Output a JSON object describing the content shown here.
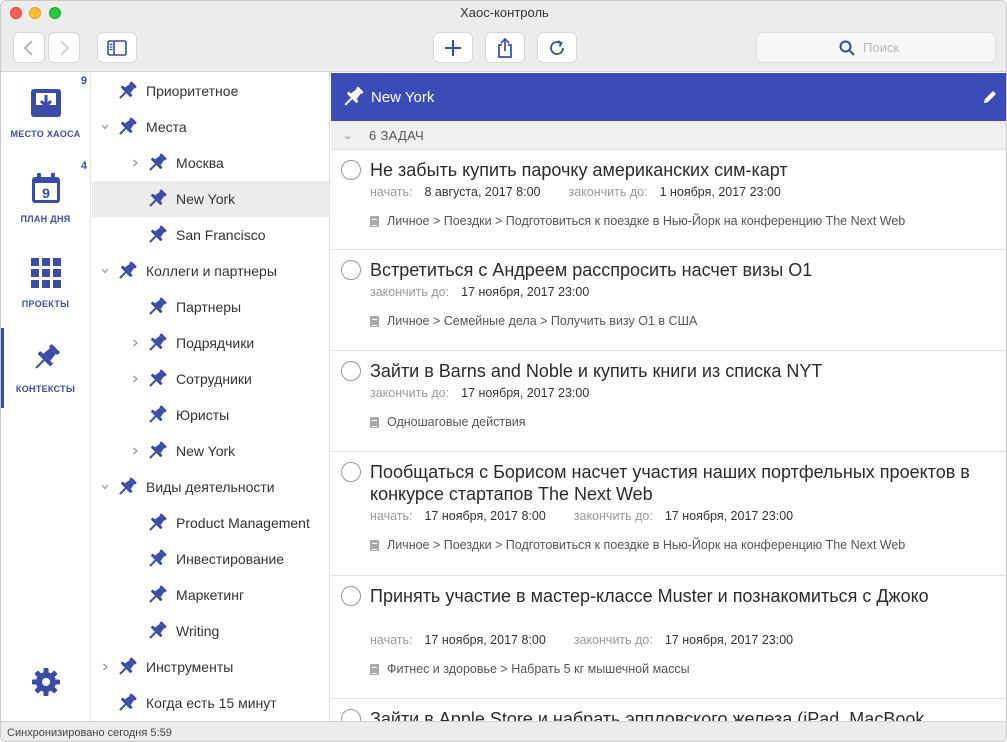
{
  "window": {
    "title": "Хаос-контроль"
  },
  "toolbar": {
    "back_icon": "chevron-left-icon",
    "forward_icon": "chevron-right-icon",
    "sidebar_icon": "sidebar-icon",
    "add_icon": "plus-icon",
    "share_icon": "share-icon",
    "sync_icon": "refresh-icon",
    "search_placeholder": "Поиск"
  },
  "rail": {
    "items": [
      {
        "label": "МЕСТО ХАОСА",
        "count": "9",
        "icon": "inbox-icon"
      },
      {
        "label": "ПЛАН ДНЯ",
        "count": "4",
        "icon": "calendar-icon",
        "calendar_day": "9"
      },
      {
        "label": "ПРОЕКТЫ",
        "count": "",
        "icon": "grid-icon"
      },
      {
        "label": "КОНТЕКСТЫ",
        "count": "",
        "icon": "pin-icon"
      }
    ],
    "settings_icon": "gear-icon"
  },
  "tree": {
    "items": [
      {
        "label": "Приоритетное"
      },
      {
        "label": "Места"
      },
      {
        "label": "Москва"
      },
      {
        "label": "New York"
      },
      {
        "label": "San Francisco"
      },
      {
        "label": "Коллеги и партнеры"
      },
      {
        "label": "Партнеры"
      },
      {
        "label": "Подрядчики"
      },
      {
        "label": "Сотрудники"
      },
      {
        "label": "Юристы"
      },
      {
        "label": "New York"
      },
      {
        "label": "Виды деятельности"
      },
      {
        "label": "Product Management"
      },
      {
        "label": "Инвестирование"
      },
      {
        "label": "Маркетинг"
      },
      {
        "label": "Writing"
      },
      {
        "label": "Инструменты"
      },
      {
        "label": "Когда есть 15 минут"
      }
    ]
  },
  "main": {
    "header_title": "New York",
    "task_count": "6 ЗАДАЧ",
    "tasks": [
      {
        "title": "Не забыть купить парочку американских сим-карт",
        "start_label": "начать:",
        "start": "8 августа, 2017 8:00",
        "due_label": "закончить до:",
        "due": "1 ноября, 2017 23:00",
        "path": "Личное > Поездки > Подготовиться к поездке в Нью-Йорк на конференцию The Next Web"
      },
      {
        "title": "Встретиться с Андреем расспросить насчет визы О1",
        "due_label": "закончить до:",
        "due": "17 ноября, 2017 23:00",
        "path": "Личное > Семейные дела > Получить визу О1 в США"
      },
      {
        "title": "Зайти в Barns and Noble и купить книги из списка NYT",
        "due_label": "закончить до:",
        "due": "17 ноября, 2017 23:00",
        "path": "Одношаговые действия"
      },
      {
        "title": "Пообщаться с Борисом насчет участия наших портфельных проектов в конкурсе стартапов The Next Web",
        "start_label": "начать:",
        "start": "17 ноября, 2017 8:00",
        "due_label": "закончить до:",
        "due": "17 ноября, 2017 23:00",
        "path": "Личное > Поездки > Подготовиться к поездке в Нью-Йорк на конференцию The Next Web"
      },
      {
        "title": "Принять участие в мастер-классе Muster и познакомиться с Джоко",
        "start_label": "начать:",
        "start": "17 ноября, 2017 8:00",
        "due_label": "закончить до:",
        "due": "17 ноября, 2017 23:00",
        "path": "Фитнес и здоровье > Набрать 5 кг мышечной массы"
      },
      {
        "title": "Зайти в Apple Store и набрать эппловского железа (iPad, MacBook"
      }
    ]
  },
  "status": {
    "text": "Синхронизировано сегодня 5:59"
  },
  "colors": {
    "accent": "#3b4cb8",
    "rail_text": "#3a4ca8"
  }
}
